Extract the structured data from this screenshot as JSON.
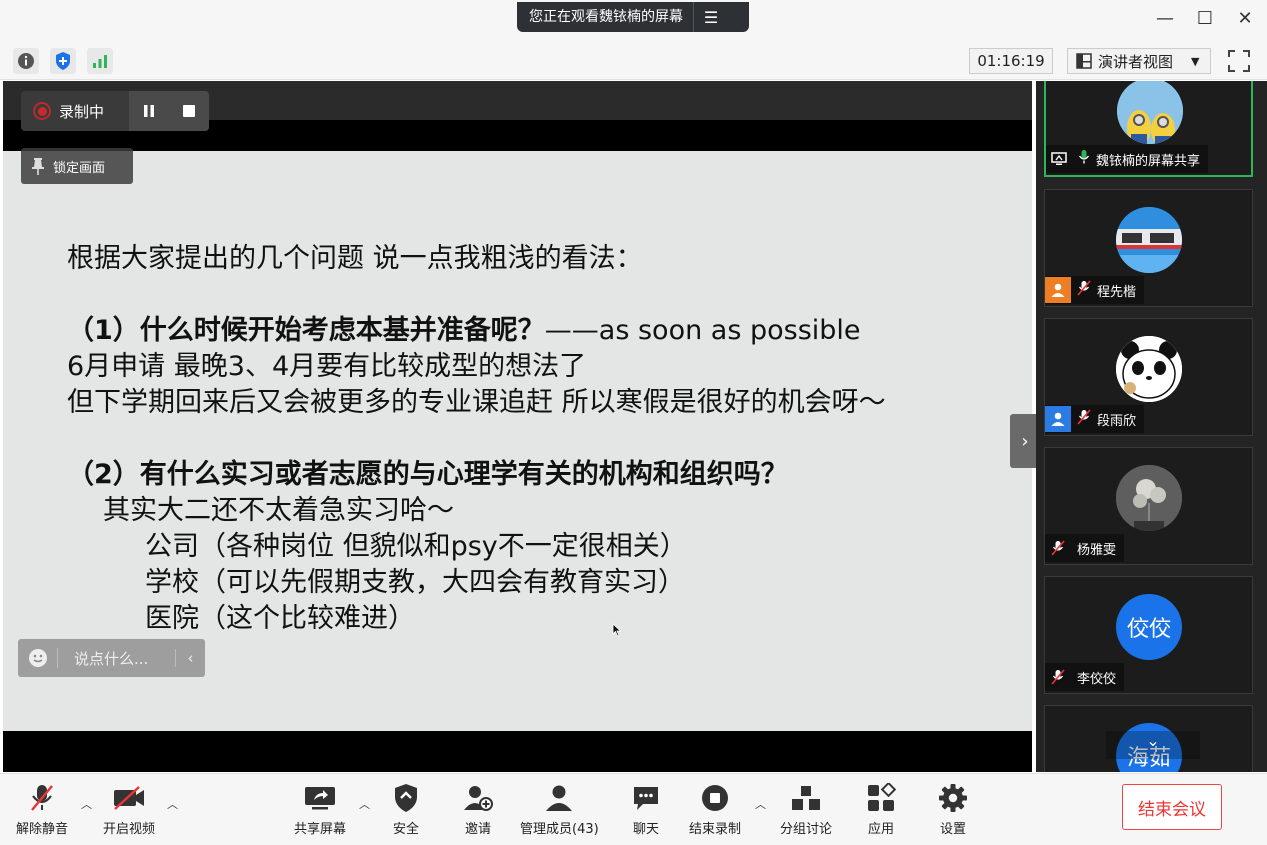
{
  "titlebar": {
    "share_banner": "您正在观看魏铱楠的屏幕",
    "menu_icon": "list-icon",
    "controls": [
      "minimize-icon",
      "maximize-icon",
      "close-icon"
    ]
  },
  "toolrow": {
    "icons": [
      "info-icon",
      "shield-icon",
      "signal-icon"
    ],
    "timer": "01:16:19",
    "view_mode": "演讲者视图",
    "fullscreen_icon": "fullscreen-icon"
  },
  "recording": {
    "label": "录制中"
  },
  "lock_view": {
    "label": "锁定画面"
  },
  "chat_input": {
    "placeholder": "说点什么..."
  },
  "slide": {
    "line1": "根据大家提出的几个问题 说一点我粗浅的看法：",
    "q1_bold": "（1）什么时候开始考虑本基并准备呢？",
    "q1_rest": "——as soon as possible",
    "a1_1": "6月申请 最晚3、4月要有比较成型的想法了",
    "a1_2": "但下学期回来后又会被更多的专业课追赶 所以寒假是很好的机会呀～",
    "q2_bold": "（2）有什么实习或者志愿的与心理学有关的机构和组织吗？",
    "a2_1": "其实大二还不太着急实习哈～",
    "a2_2": "公司（各种岗位 但貌似和psy不一定很相关）",
    "a2_3": "学校（可以先假期支教，大四会有教育实习）",
    "a2_4": "医院（这个比较难进）"
  },
  "participants": [
    {
      "name": "魏铱楠的屏幕共享",
      "avatar": "minion-avatar"
    },
    {
      "name": "程先楷",
      "avatar": "train-avatar"
    },
    {
      "name": "段雨欣",
      "avatar": "panda-avatar"
    },
    {
      "name": "杨雅雯",
      "avatar": "flower-avatar"
    },
    {
      "name": "李佼佼",
      "avatar_text": "佼佼"
    },
    {
      "avatar_text": "海茹"
    }
  ],
  "bottombar": {
    "unmute": "解除静音",
    "start_video": "开启视频",
    "share_screen": "共享屏幕",
    "security": "安全",
    "invite": "邀请",
    "manage": "管理成员(43)",
    "chat": "聊天",
    "stop_recording": "结束录制",
    "breakout": "分组讨论",
    "apps": "应用",
    "settings": "设置",
    "end_meeting": "结束会议"
  },
  "colors": {
    "accent_blue": "#1a73e8",
    "end_red": "#e33333",
    "active_green": "#2fb45a"
  }
}
